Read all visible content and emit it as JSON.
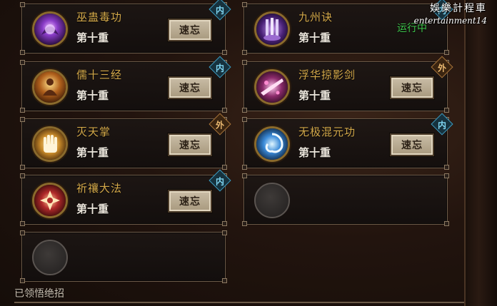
{
  "watermark": {
    "line1": "娛樂計程車",
    "line2": "entertainment14"
  },
  "skills": [
    {
      "name": "巫蛊毒功",
      "level": "第十重",
      "button": "速忘",
      "badge": "内",
      "badge_type": "nei",
      "icon": "purple-skull-swirl-icon",
      "color": "#8a3cc8"
    },
    {
      "name": "九州诀",
      "level": "第十重",
      "status": "运行中",
      "badge": "内",
      "badge_type": "nei",
      "icon": "purple-pillars-icon",
      "color": "#6a3a9a"
    },
    {
      "name": "儒十三经",
      "level": "第十重",
      "button": "速忘",
      "badge": "内",
      "badge_type": "nei",
      "icon": "meditating-scholar-icon",
      "color": "#b0601c"
    },
    {
      "name": "浮华掠影剑",
      "level": "第十重",
      "button": "速忘",
      "badge": "外",
      "badge_type": "wai",
      "icon": "pink-sword-slash-icon",
      "color": "#d44a9a"
    },
    {
      "name": "灭天掌",
      "level": "第十重",
      "button": "速忘",
      "badge": "外",
      "badge_type": "wai",
      "icon": "golden-palm-icon",
      "color": "#d8a032"
    },
    {
      "name": "无极混元功",
      "level": "第十重",
      "button": "速忘",
      "badge": "内",
      "badge_type": "nei",
      "icon": "blue-vortex-icon",
      "color": "#3a8ad8"
    },
    {
      "name": "祈禳大法",
      "level": "第十重",
      "button": "速忘",
      "badge": "内",
      "badge_type": "nei",
      "icon": "red-rune-icon",
      "color": "#b02a2a"
    }
  ],
  "section_label": "已领悟绝招"
}
